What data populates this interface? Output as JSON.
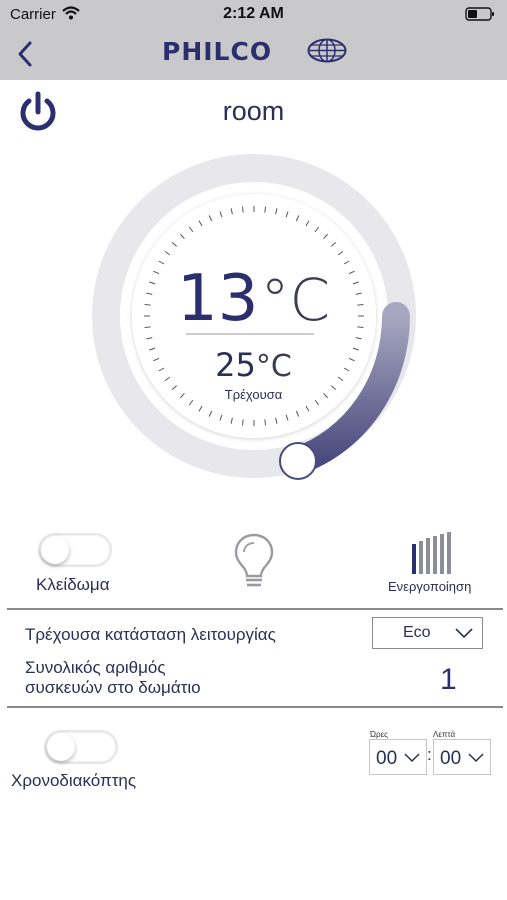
{
  "status_bar": {
    "carrier": "Carrier",
    "time": "2:12 AM",
    "wifi_icon": "wifi-icon",
    "battery_icon": "battery-icon"
  },
  "nav": {
    "back_icon": "chevron-left-icon",
    "brand": "PHILCO",
    "brand_icon": "globe-grid-icon"
  },
  "header": {
    "power_icon": "power-icon",
    "room_name": "room"
  },
  "dial": {
    "set_temperature": "13",
    "set_unit": "°C",
    "current_temperature": "25",
    "current_unit": "°C",
    "current_label": "Τρέχουσα"
  },
  "controls": {
    "lock_label": "Κλείδωμα",
    "lock_on": false,
    "bulb_icon": "light-bulb-icon",
    "activation_label": "Ενεργοποίηση",
    "activation_icon": "signal-bars-icon"
  },
  "info": {
    "mode_label": "Τρέχουσα κατάσταση λειτουργίας",
    "mode_value": "Eco",
    "devices_label_line1": "Συνολικός αριθμός",
    "devices_label_line2": "συσκευών στο δωμάτιο",
    "devices_count": "1"
  },
  "timer": {
    "label": "Χρονοδιακόπτης",
    "enabled": false,
    "hours_caption": "Ώρες",
    "minutes_caption": "Λεπτά",
    "hours_value": "00",
    "minutes_value": "00",
    "separator": ":"
  },
  "colors": {
    "brand_navy": "#2b2f6e",
    "bar_gray": "#c9c9cc",
    "dial_ring": "#e8e8ec",
    "arc_gradient_start": "#a7a7c1",
    "arc_gradient_end": "#4b4a7e"
  }
}
